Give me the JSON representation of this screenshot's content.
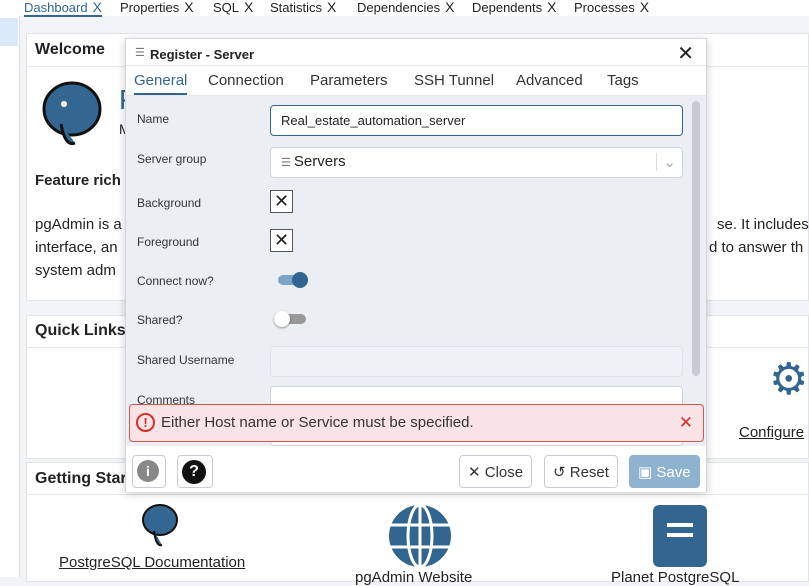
{
  "tabs": [
    {
      "label": "Dashboard",
      "active": true
    },
    {
      "label": "Properties"
    },
    {
      "label": "SQL"
    },
    {
      "label": "Statistics"
    },
    {
      "label": "Dependencies"
    },
    {
      "label": "Dependents"
    },
    {
      "label": "Processes"
    }
  ],
  "tab_close": "X",
  "welcome": {
    "title": "Welcome",
    "logo_partial": "P",
    "subtitle_partial": "M",
    "feature_heading": "Feature rich",
    "lines": [
      "pgAdmin is a",
      "interface, an",
      "system adm"
    ],
    "right_lines": [
      "se. It includes",
      "d to answer th"
    ]
  },
  "quick_links": {
    "title": "Quick Links",
    "configure": "Configure"
  },
  "getting_started": {
    "title": "Getting Start",
    "links": [
      "PostgreSQL Documentation",
      "pgAdmin Website",
      "Planet PostgreSQL"
    ]
  },
  "dialog": {
    "title": "Register - Server",
    "close": "✕",
    "tabs": [
      "General",
      "Connection",
      "Parameters",
      "SSH Tunnel",
      "Advanced",
      "Tags"
    ],
    "fields": {
      "name_label": "Name",
      "name_value": "Real_estate_automation_server",
      "server_group_label": "Server group",
      "server_group_value": "Servers",
      "background_label": "Background",
      "foreground_label": "Foreground",
      "connect_now_label": "Connect now?",
      "connect_now": true,
      "shared_label": "Shared?",
      "shared": false,
      "shared_username_label": "Shared Username",
      "comments_label": "Comments"
    },
    "error": "Either Host name or Service must be specified.",
    "error_close": "✕",
    "buttons": {
      "info": "i",
      "help": "?",
      "close": "Close",
      "reset": "Reset",
      "save": "Save"
    }
  },
  "colors": {
    "accent": "#326690",
    "error": "#d9534f",
    "save_disabled": "#8fb2d1"
  }
}
